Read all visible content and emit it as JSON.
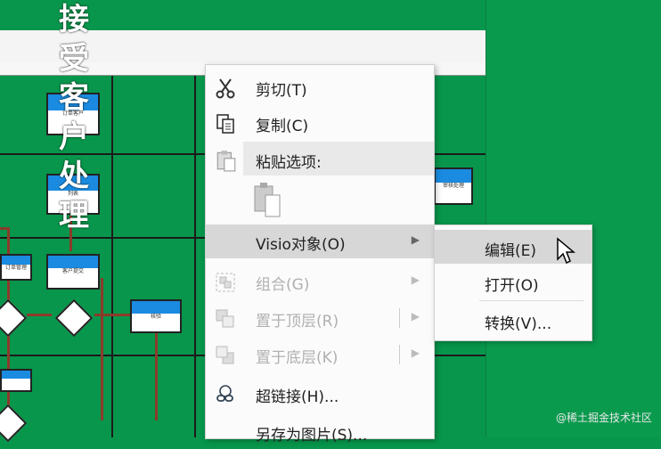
{
  "background": {
    "title_vertical": "接受客户处理",
    "nodes": [
      "订单客户",
      "列表",
      "订单管理",
      "客户提交",
      "核验",
      "审核处理"
    ]
  },
  "context_menu": {
    "cut": "剪切(T)",
    "copy": "复制(C)",
    "paste_options": "粘贴选项:",
    "visio_object": "Visio对象(O)",
    "group": "组合(G)",
    "bring_to_front": "置于顶层(R)",
    "send_to_back": "置于底层(K)",
    "hyperlink": "超链接(H)...",
    "save_as_picture": "另存为图片(S)..."
  },
  "submenu": {
    "edit": "编辑(E)",
    "open": "打开(O)",
    "convert": "转换(V)..."
  },
  "watermark": "@稀土掘金技术社区",
  "colors": {
    "background": "#07964b",
    "highlight": "#d7d7d7",
    "menu_bg": "#fbfbfb"
  }
}
